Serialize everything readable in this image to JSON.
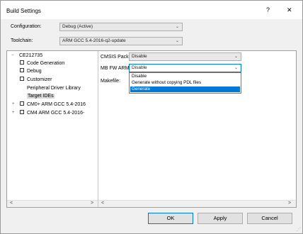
{
  "window": {
    "title": "Build Settings",
    "help_label": "?",
    "close_label": "✕"
  },
  "configuration": {
    "label": "Configuration:",
    "value": "Debug (Active)"
  },
  "toolchain": {
    "label": "Toolchain:",
    "value": "ARM GCC 5.4-2016-q2-update"
  },
  "tree": {
    "root_expander": "−",
    "root": "CE212735",
    "items": [
      {
        "label": "Code Generation"
      },
      {
        "label": "Debug"
      },
      {
        "label": "Customizer"
      },
      {
        "label": "Peripheral Driver Library"
      },
      {
        "label": "Target IDEs"
      },
      {
        "label": "CM0+ ARM GCC 5.4-2016"
      },
      {
        "label": "CM4 ARM GCC 5.4-2016-"
      }
    ],
    "expanders": [
      "+",
      "+"
    ]
  },
  "properties": {
    "cmsis_pack": {
      "label": "CMSIS Pack:",
      "value": "Disable"
    },
    "mbed_fw_arm": {
      "label": "MB FW ARM:",
      "value": "Disable"
    },
    "makefile": {
      "label": "Makefile:"
    },
    "dropdown_options": [
      {
        "label": "Disable",
        "selected": false
      },
      {
        "label": "Generate without copying PDL files",
        "selected": false
      },
      {
        "label": "Generate",
        "selected": true
      }
    ]
  },
  "scroll": {
    "left_arrow": "<",
    "right_arrow": ">"
  },
  "buttons": {
    "ok": "OK",
    "apply": "Apply",
    "cancel": "Cancel"
  },
  "colors": {
    "selection": "#0078d7",
    "default_button_border": "#0078d7"
  }
}
